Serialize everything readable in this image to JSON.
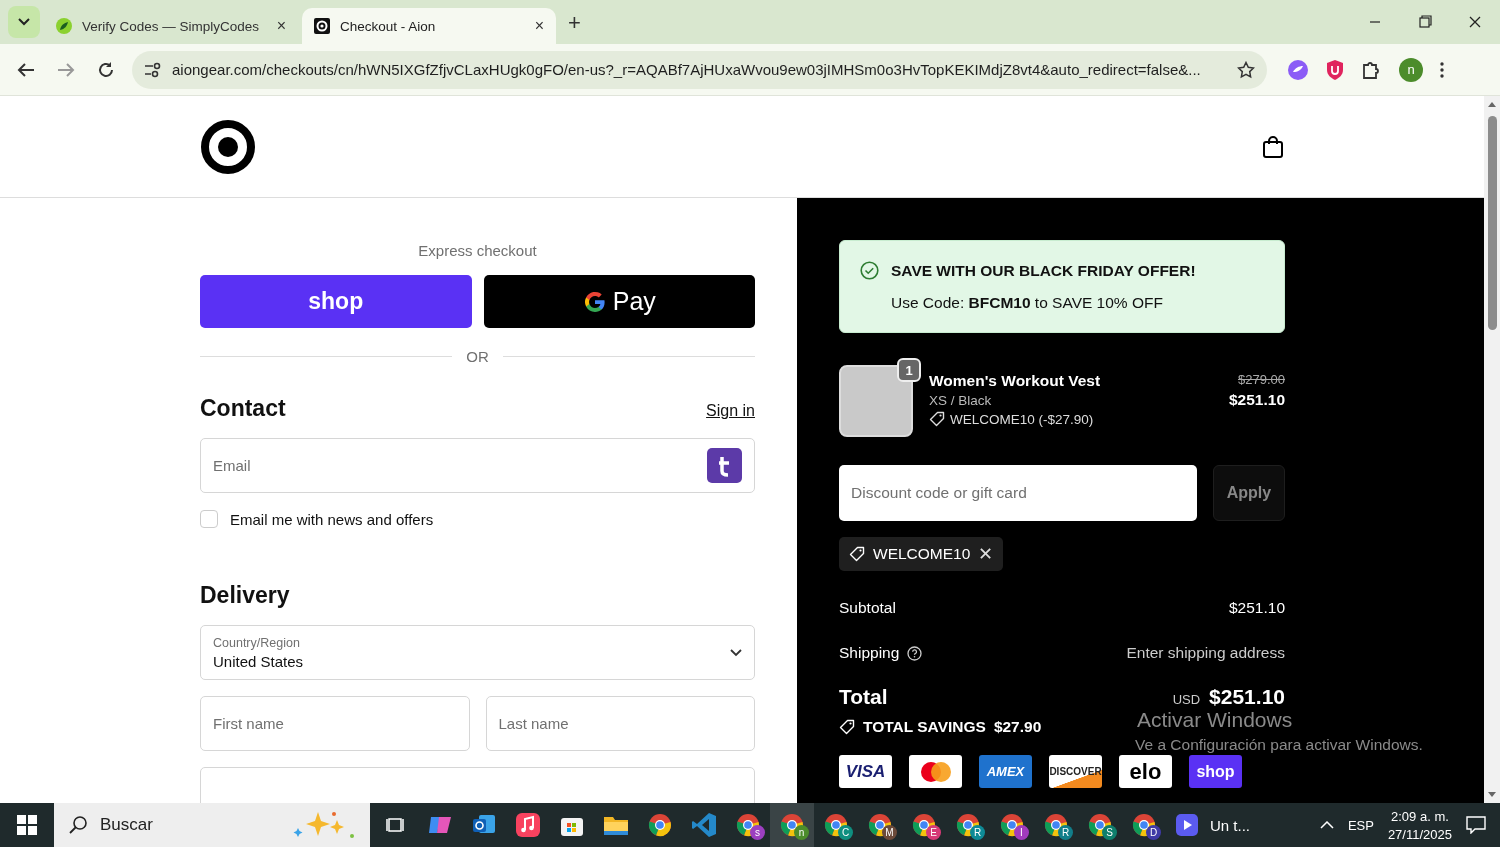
{
  "browser": {
    "tabs": [
      {
        "title": "Verify Codes — SimplyCodes",
        "selected": false,
        "close": "×"
      },
      {
        "title": "Checkout - Aion",
        "selected": true,
        "close": "×"
      }
    ],
    "new_tab": "+",
    "url": "aiongear.com/checkouts/cn/hWN5IXGfZfjvCLaxHUgk0gFO/en-us?_r=AQABf7AjHUxaWvou9ew03jIMHSm0o3HvTopKEKIMdjZ8vt4&auto_redirect=false&...",
    "profile_initial": "n"
  },
  "checkout": {
    "express_label": "Express checkout",
    "express_buttons": [
      {
        "kind": "shop",
        "label": "shop"
      },
      {
        "kind": "gpay",
        "label": "Pay"
      }
    ],
    "divider": "OR",
    "contact": {
      "title": "Contact",
      "sign_in": "Sign in",
      "email_placeholder": "Email",
      "newsletter": {
        "label": "Email me with news and offers",
        "checked": false
      }
    },
    "delivery": {
      "title": "Delivery",
      "country_label": "Country/Region",
      "country_value": "United States",
      "first_name": "First name",
      "last_name": "Last name"
    }
  },
  "summary": {
    "promo": {
      "title": "SAVE WITH OUR BLACK FRIDAY OFFER!",
      "text": "Use Code: **BFCM10** to SAVE 10% OFF"
    },
    "items": [
      {
        "name": "Women's Workout Vest",
        "variant": "XS / Black",
        "discount": "WELCOME10 (-$27.90)",
        "quantity": "1",
        "original_price": "$279.00",
        "price": "$251.10"
      }
    ],
    "discount_placeholder": "Discount code or gift card",
    "apply": "Apply",
    "applied_codes": [
      {
        "code": "WELCOME10",
        "remove": "✕"
      }
    ],
    "subtotal": {
      "label": "Subtotal",
      "value": "$251.10"
    },
    "shipping": {
      "label": "Shipping",
      "value": "Enter shipping address"
    },
    "total": {
      "label": "Total",
      "currency": "USD",
      "value": "$251.10"
    },
    "savings": {
      "label": "TOTAL SAVINGS",
      "value": "$27.90"
    },
    "payment_methods": [
      {
        "kind": "visa",
        "label": "VISA"
      },
      {
        "kind": "mastercard"
      },
      {
        "kind": "amex",
        "label": "AMEX"
      },
      {
        "kind": "discover",
        "label": "DISCOVER"
      },
      {
        "kind": "elo",
        "label": "elo"
      },
      {
        "kind": "shop",
        "label": "shop"
      }
    ]
  },
  "watermark": {
    "title": "Activar Windows",
    "text": "Ve a Configuración para activar Windows."
  },
  "taskbar": {
    "search": "Buscar",
    "apps": [
      {
        "kind": "task-view"
      },
      {
        "kind": "copilot"
      },
      {
        "kind": "mail"
      },
      {
        "kind": "music"
      },
      {
        "kind": "store"
      },
      {
        "kind": "folder"
      },
      {
        "kind": "browser"
      },
      {
        "kind": "code"
      }
    ],
    "browser_profiles": [
      {
        "letter": "s",
        "color": "#9c3fc0",
        "selected": false
      },
      {
        "letter": "n",
        "color": "#4c8c2b",
        "selected": true
      },
      {
        "letter": "C",
        "color": "#0f8f80",
        "selected": false
      },
      {
        "letter": "M",
        "color": "#6b4a3a",
        "selected": false
      },
      {
        "letter": "E",
        "color": "#d63a77",
        "selected": false
      },
      {
        "letter": "R",
        "color": "#0e8a96",
        "selected": false
      },
      {
        "letter": "I",
        "color": "#a13bbd",
        "selected": false
      },
      {
        "letter": "R",
        "color": "#127e8a",
        "selected": false
      },
      {
        "letter": "S",
        "color": "#0f7f6c",
        "selected": false
      },
      {
        "letter": "D",
        "color": "#3f3aa6",
        "selected": false
      }
    ],
    "media": "Un t...",
    "language": "ESP",
    "time": "2:09 a. m.",
    "date": "27/11/2025"
  }
}
